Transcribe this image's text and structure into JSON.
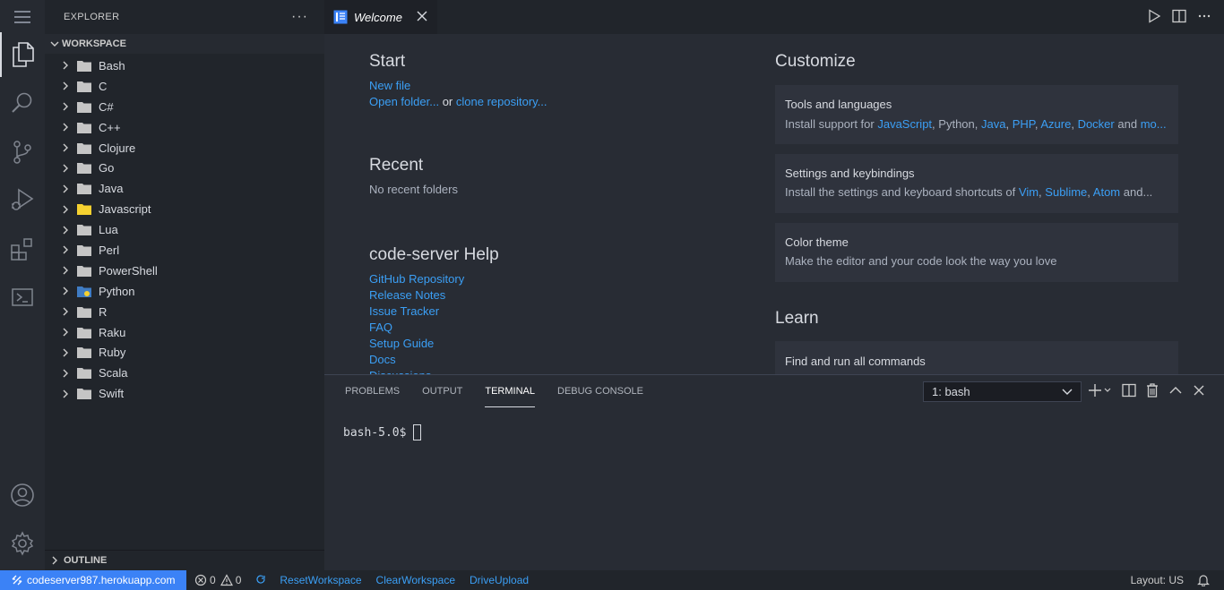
{
  "sidebar": {
    "title": "EXPLORER",
    "more": "···",
    "workspace_label": "WORKSPACE",
    "folders": [
      "Bash",
      "C",
      "C#",
      "C++",
      "Clojure",
      "Go",
      "Java",
      "Javascript",
      "Lua",
      "Perl",
      "PowerShell",
      "Python",
      "R",
      "Raku",
      "Ruby",
      "Scala",
      "Swift"
    ],
    "outline_label": "OUTLINE"
  },
  "tabs": [
    {
      "label": "Welcome"
    }
  ],
  "welcome": {
    "start": {
      "heading": "Start",
      "new_file": "New file",
      "open_folder": "Open folder...",
      "or_text": "or",
      "clone_repo": "clone repository..."
    },
    "recent": {
      "heading": "Recent",
      "empty": "No recent folders"
    },
    "help": {
      "heading": "code-server Help",
      "links": [
        "GitHub Repository",
        "Release Notes",
        "Issue Tracker",
        "FAQ",
        "Setup Guide",
        "Docs",
        "Discussions"
      ]
    },
    "customize": {
      "heading": "Customize",
      "tools": {
        "title": "Tools and languages",
        "prefix": "Install support for",
        "l1": "JavaScript",
        "s1": ",",
        "l2": "Python",
        "s2": ",",
        "l3": "Java",
        "s3": ",",
        "l4": "PHP",
        "s4": ",",
        "l5": "Azure",
        "s5": ",",
        "l6": "Docker",
        "and_text": "and",
        "l7": "mo..."
      },
      "settings": {
        "title": "Settings and keybindings",
        "prefix": "Install the settings and keyboard shortcuts of",
        "l1": "Vim",
        "s1": ",",
        "l2": "Sublime",
        "s2": ",",
        "l3": "Atom",
        "suffix": "and..."
      },
      "theme": {
        "title": "Color theme",
        "desc": "Make the editor and your code look the way you love"
      }
    },
    "learn": {
      "heading": "Learn",
      "commands_title": "Find and run all commands"
    }
  },
  "panel": {
    "tabs": [
      "PROBLEMS",
      "OUTPUT",
      "TERMINAL",
      "DEBUG CONSOLE"
    ],
    "active_tab": "TERMINAL",
    "terminal_selected": "1: bash",
    "prompt": "bash-5.0$"
  },
  "status": {
    "remote": "codeserver987.herokuapp.com",
    "errors": "0",
    "warnings": "0",
    "reset": "ResetWorkspace",
    "clear": "ClearWorkspace",
    "upload": "DriveUpload",
    "layout": "Layout: US"
  },
  "colors": {
    "accent": "#3b82f6",
    "link": "#3b9ff5",
    "folder": "#c5c5c5",
    "js_folder": "#f5d130",
    "py_folder": "#3f7cc4"
  }
}
